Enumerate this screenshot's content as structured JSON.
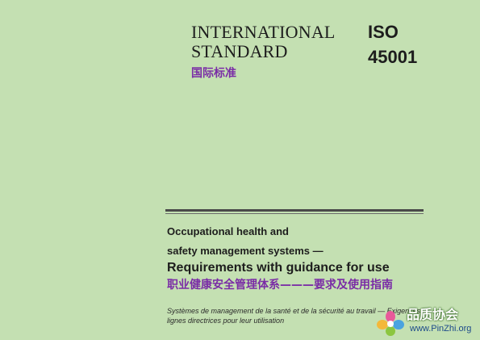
{
  "header": {
    "intl_line1": "INTERNATIONAL",
    "intl_line2": "STANDARD",
    "intl_cn": "国际标准",
    "iso_label": "ISO",
    "iso_number": "45001"
  },
  "title": {
    "en_line1": "Occupational health and",
    "en_line2": "safety management systems —",
    "en_line3": "Requirements with guidance for use",
    "cn": "职业健康安全管理体系———要求及使用指南",
    "fr_line1": "Systèmes de management de la santé et de la sécurité au travail — Exigences et",
    "fr_line2": "lignes directrices pour leur utilisation"
  },
  "watermark": {
    "cn": "品质协会",
    "url": "www.PinZhi.org"
  },
  "colors": {
    "background": "#c4e0b2",
    "text": "#1d1d1d",
    "chinese_accent": "#7a2ca6"
  }
}
